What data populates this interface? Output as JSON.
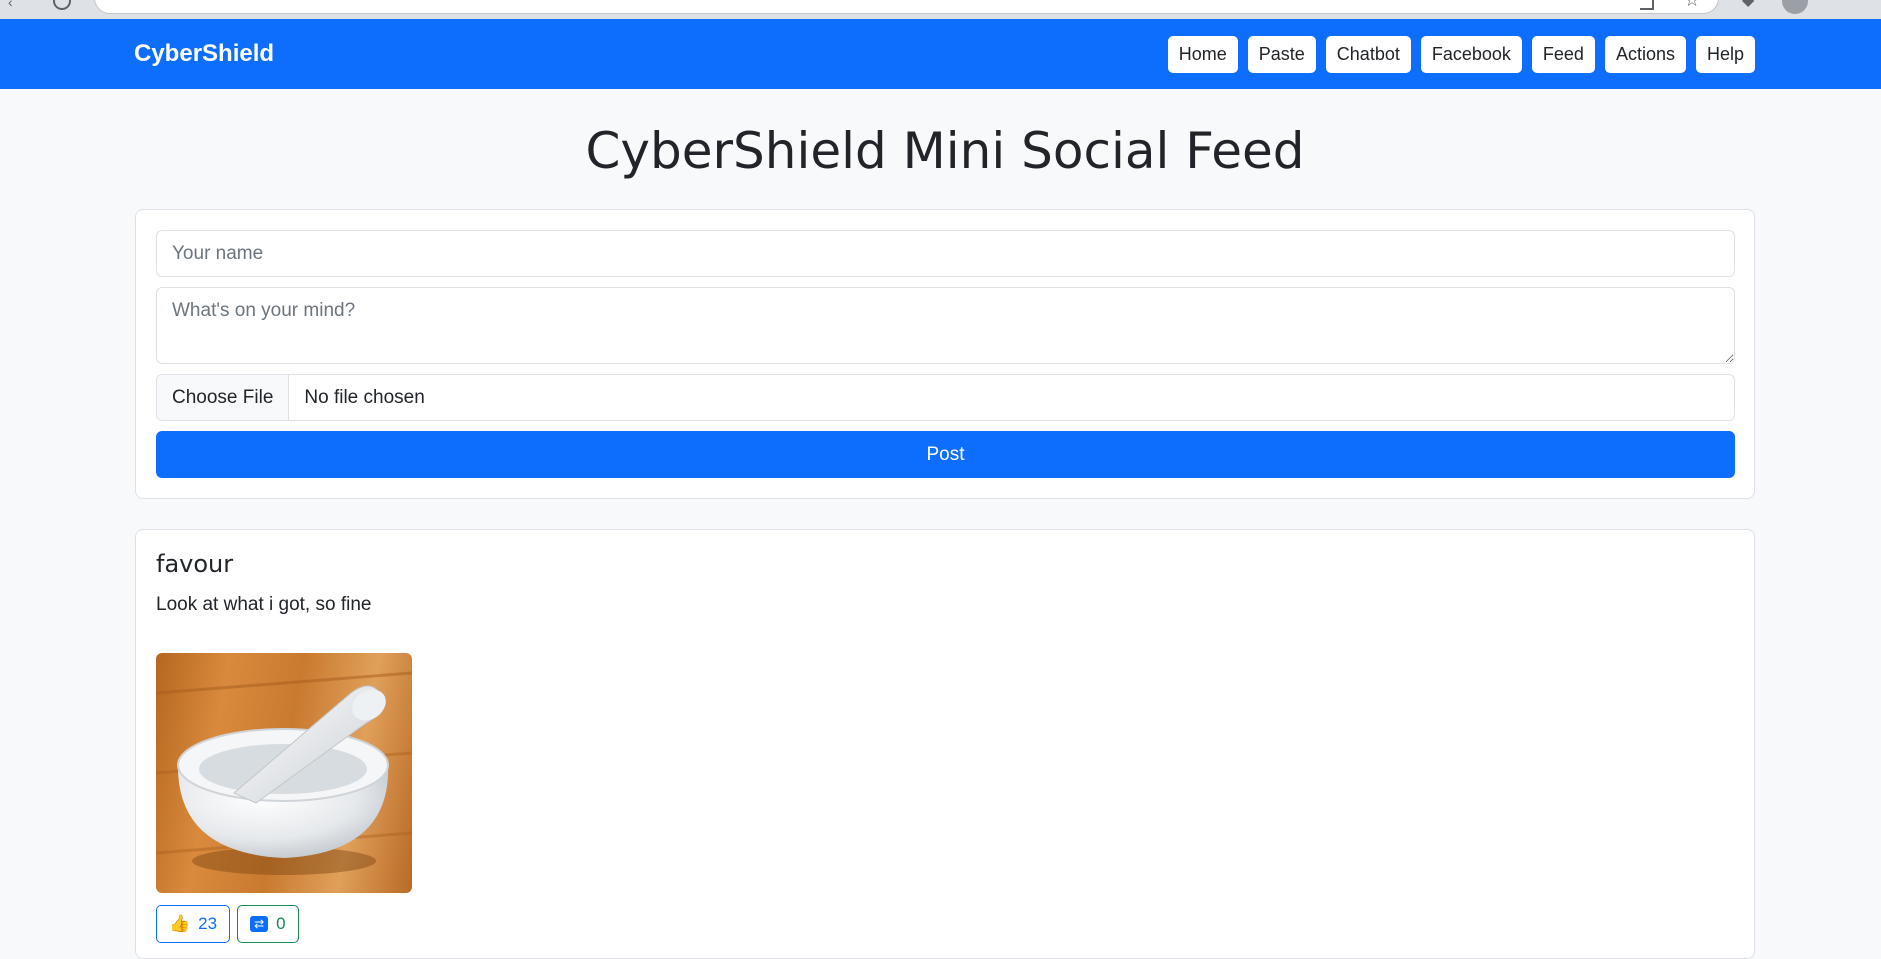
{
  "navbar": {
    "brand": "CyberShield",
    "links": [
      "Home",
      "Paste",
      "Chatbot",
      "Facebook",
      "Feed",
      "Actions",
      "Help"
    ],
    "color": "#0d6efd"
  },
  "main": {
    "title": "CyberShield Mini Social Feed"
  },
  "form": {
    "name_placeholder": "Your name",
    "name_value": "",
    "message_placeholder": "What's on your mind?",
    "message_value": "",
    "file_button": "Choose File",
    "file_status": "No file chosen",
    "submit_label": "Post"
  },
  "post": {
    "author": "favour",
    "text": "Look at what i got, so fine",
    "image_icon": "mortar-and-pestle-photo",
    "like_icon": "thumbs-up-icon",
    "likes": "23",
    "share_icon": "repost-icon",
    "shares": "0"
  }
}
